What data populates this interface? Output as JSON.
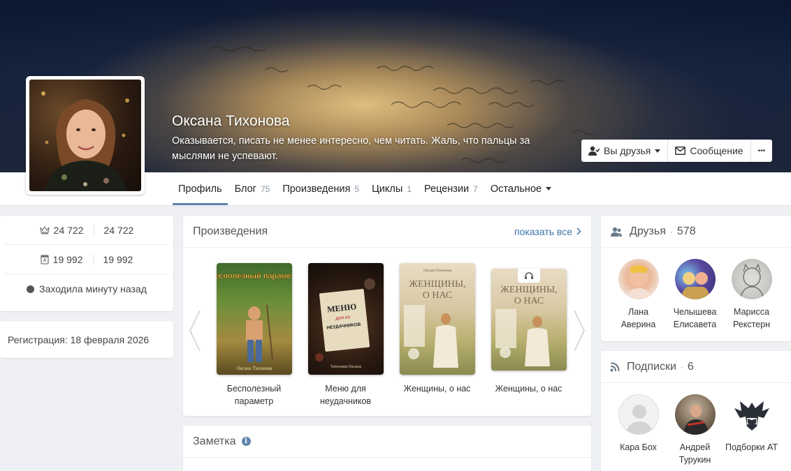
{
  "profile": {
    "name": "Оксана Тихонова",
    "status": "Оказывается, писать не менее интересно, чем читать. Жаль, что пальцы за мыслями не успевают."
  },
  "actions": {
    "friends_label": "Вы друзья",
    "message_label": "Сообщение",
    "more_label": "•••"
  },
  "tabs": [
    {
      "label": "Профиль",
      "count": ""
    },
    {
      "label": "Блог",
      "count": "75"
    },
    {
      "label": "Произведения",
      "count": "5"
    },
    {
      "label": "Циклы",
      "count": "1"
    },
    {
      "label": "Рецензии",
      "count": "7"
    },
    {
      "label": "Остальное",
      "count": ""
    }
  ],
  "stats": {
    "rating_a": "24 722",
    "rating_b": "24 722",
    "books_a": "19 992",
    "books_b": "19 992",
    "online": "Заходила минуту назад"
  },
  "registration": "Регистрация: 18 февраля 2026",
  "works": {
    "title": "Произведения",
    "show_all": "показать все",
    "books": [
      {
        "title": "Бесполезный параметр",
        "cover_title": "Бесполезный параметр",
        "cover_author": "Оксана Тихонова"
      },
      {
        "title": "Меню для неудачников",
        "cover_title": "Меню для из неудачников",
        "cover_author": "Тихонова Оксана"
      },
      {
        "title": "Женщины, о нас",
        "cover_title": "Женщины, о нас",
        "cover_author": "Оксана Тихонова"
      },
      {
        "title": "Женщины, о нас",
        "cover_title": "Женщины, о нас",
        "cover_author": ""
      }
    ]
  },
  "note": {
    "title": "Заметка",
    "info": "i"
  },
  "friends": {
    "title": "Друзья",
    "count": "578",
    "people": [
      {
        "name": "Лана Аверина"
      },
      {
        "name": "Челышева Елисавета"
      },
      {
        "name": "Марисса Рекстерн"
      }
    ]
  },
  "subscriptions": {
    "title": "Подписки",
    "count": "6",
    "people": [
      {
        "name": "Кара Бох"
      },
      {
        "name": "Андрей Турукин"
      },
      {
        "name": "Подборки АТ"
      }
    ]
  },
  "colors": {
    "accent": "#5f86ad",
    "link": "#3d73a8",
    "page_bg": "#eef0f3"
  }
}
